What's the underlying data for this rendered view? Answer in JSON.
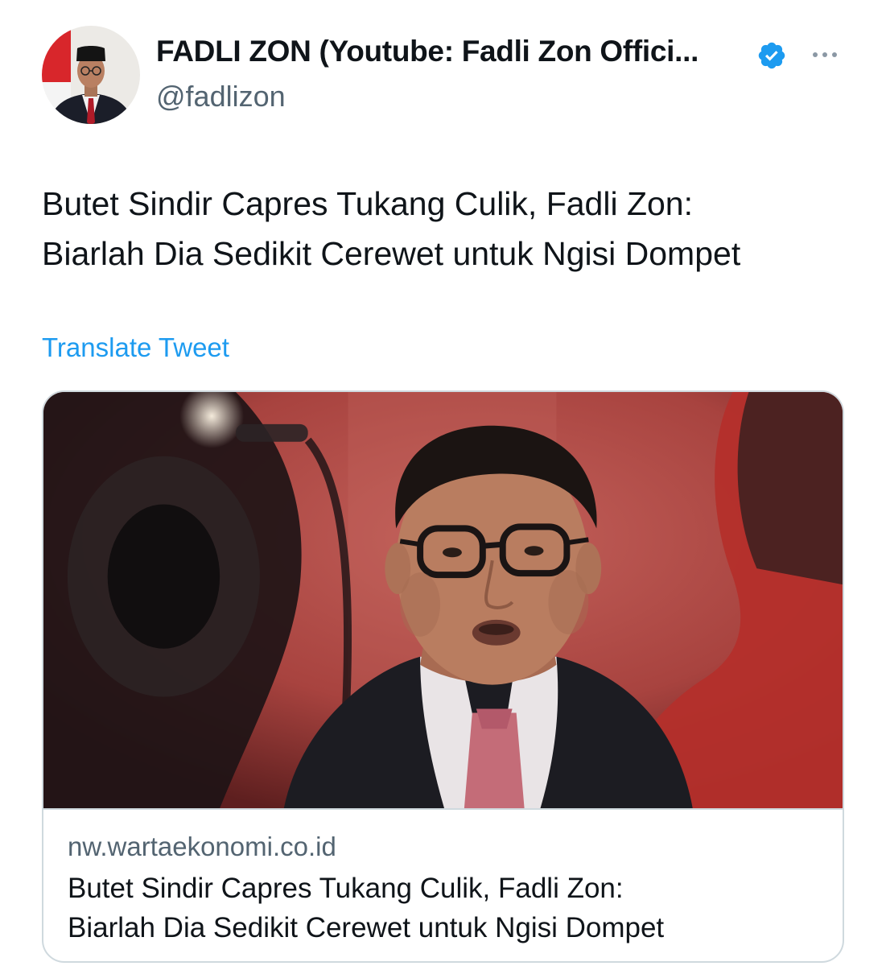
{
  "author": {
    "display_name": "FADLI ZON (Youtube: Fadli Zon Offici...",
    "handle": "@fadlizon",
    "verified": true,
    "avatar_icon": "profile-photo"
  },
  "tweet": {
    "text_lines": [
      "Butet Sindir Capres Tukang Culik, Fadli Zon:",
      "Biarlah Dia Sedikit Cerewet untuk Ngisi Dompet"
    ],
    "translate_label": "Translate Tweet"
  },
  "link_card": {
    "domain": "nw.wartaekonomi.co.id",
    "title_lines": [
      "Butet Sindir Capres Tukang Culik, Fadli Zon:",
      "Biarlah Dia Sedikit Cerewet untuk Ngisi Dompet"
    ],
    "image_icon": "article-photo"
  },
  "icons": {
    "verified": "verified-badge-icon",
    "more": "more-options-icon"
  },
  "colors": {
    "text_primary": "#0f1419",
    "text_secondary": "#536471",
    "link": "#1d9bf0",
    "verified": "#1d9bf0",
    "border": "#cfd9de",
    "photo_background": "#b34a48"
  }
}
